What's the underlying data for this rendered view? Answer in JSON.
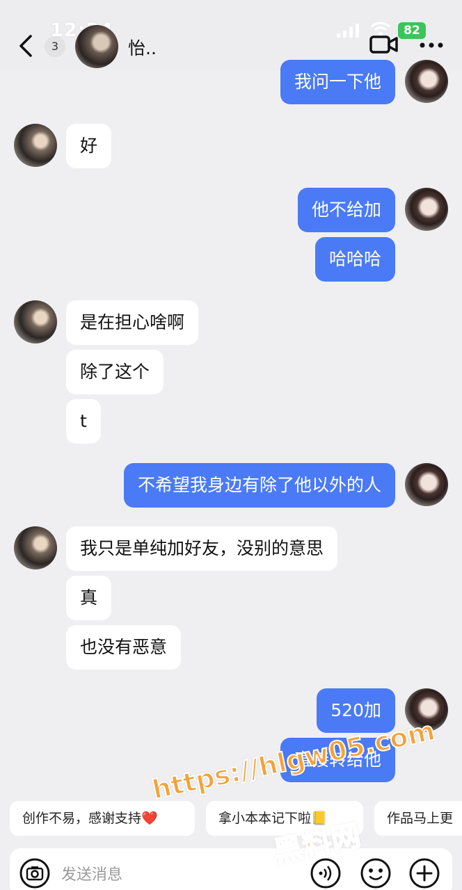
{
  "status_bar": {
    "time": "12:34",
    "battery": "82"
  },
  "header": {
    "unread_count": "3",
    "contact_name": "怡.."
  },
  "messages": {
    "m1": "我问一下他",
    "m2": "好",
    "m3": "他不给加",
    "m4": "哈哈哈",
    "m5": "是在担心啥啊",
    "m6": "除了这个",
    "m7": "t",
    "m8": "不希望我身边有除了他以外的人",
    "m9": "我只是单纯加好友，没别的意思",
    "m10": "真",
    "m11": "也没有恶意",
    "m12": "520加",
    "m13": "直接转给他"
  },
  "quick_replies": [
    "创作不易，感谢支持❤️",
    "拿小本本记下啦📒",
    "作品马上更"
  ],
  "input": {
    "placeholder": "发送消息"
  },
  "watermark": {
    "url": "https://hlgw05.com",
    "name": "黑料网"
  },
  "colors": {
    "outgoing_bubble": "#4a7af5",
    "incoming_bubble": "#ffffff",
    "background": "#efeff1"
  },
  "icons": [
    "back-icon",
    "video-call-icon",
    "more-icon",
    "camera-icon",
    "voice-icon",
    "emoji-icon",
    "plus-icon"
  ]
}
